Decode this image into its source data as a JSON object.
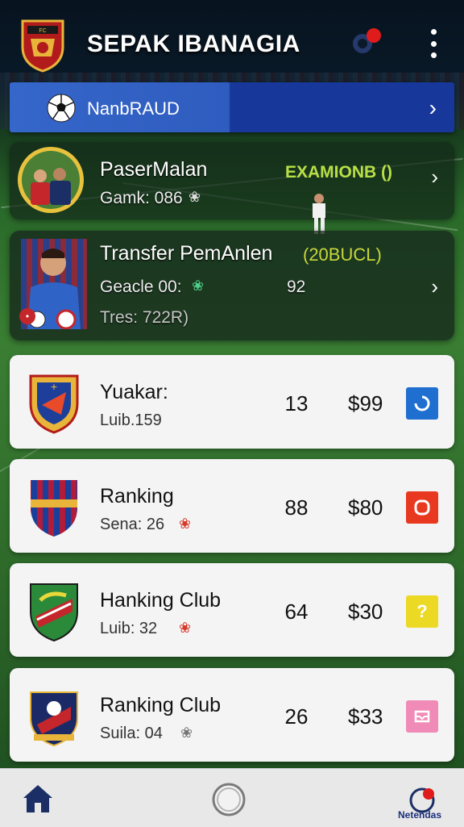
{
  "header": {
    "title": "SEPAK IBANAGIA",
    "logo_text": "FC"
  },
  "banner": {
    "label": "NanbRAUD"
  },
  "feature_cards": [
    {
      "title": "PaserMalan",
      "subtitle": "Gamk: 086",
      "tag": "EXAMIONB ()"
    },
    {
      "title": "Transfer PemAnlen",
      "tag": "(20BUCL)",
      "subtitle": "Geacle 00:",
      "value": "92",
      "detail": "Tres: 722R)"
    }
  ],
  "rankings": [
    {
      "title": "Yuakar:",
      "subtitle": "Luib.159",
      "number": "13",
      "price": "$99",
      "button_color": "#1f6fd1"
    },
    {
      "title": "Ranking",
      "subtitle": "Sena: 26",
      "number": "88",
      "price": "$80",
      "button_color": "#e8381f"
    },
    {
      "title": "Hanking Club",
      "subtitle": "Luib: 32",
      "number": "64",
      "price": "$30",
      "button_color": "#ecd923"
    },
    {
      "title": "Ranking Club",
      "subtitle": "Suila: 04",
      "number": "26",
      "price": "$33",
      "button_color": "#f08bb8"
    }
  ],
  "nav": {
    "right_label": "Netendas"
  },
  "colors": {
    "banner_blue": "#3566c9",
    "accent_green": "#b8e046"
  }
}
